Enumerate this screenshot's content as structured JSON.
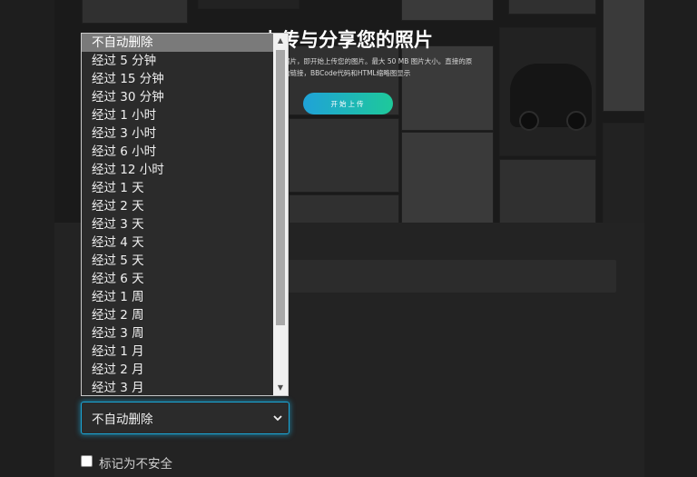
{
  "hero": {
    "title": "上传与分享您的照片",
    "description": "照片，即开始上传您的图片。最大 50 MB 图片大小。直接的原始链接，BBCode代码和HTML缩略图显示",
    "upload_button": "开始上传"
  },
  "auto_delete": {
    "selected": "不自动删除",
    "options": [
      "不自动删除",
      "经过 5 分钟",
      "经过 15 分钟",
      "经过 30 分钟",
      "经过 1 小时",
      "经过 3 小时",
      "经过 6 小时",
      "经过 12 小时",
      "经过 1 天",
      "经过 2 天",
      "经过 3 天",
      "经过 4 天",
      "经过 5 天",
      "经过 6 天",
      "经过 1 周",
      "经过 2 周",
      "经过 3 周",
      "经过 1 月",
      "经过 2 月",
      "经过 3 月"
    ]
  },
  "nsfw": {
    "label": "标记为不安全",
    "checked": false
  },
  "colors": {
    "accent": "#1aa6d6",
    "button_gradient_start": "#1fa2d8",
    "button_gradient_end": "#1ec99a",
    "background": "#1e1e1e"
  }
}
